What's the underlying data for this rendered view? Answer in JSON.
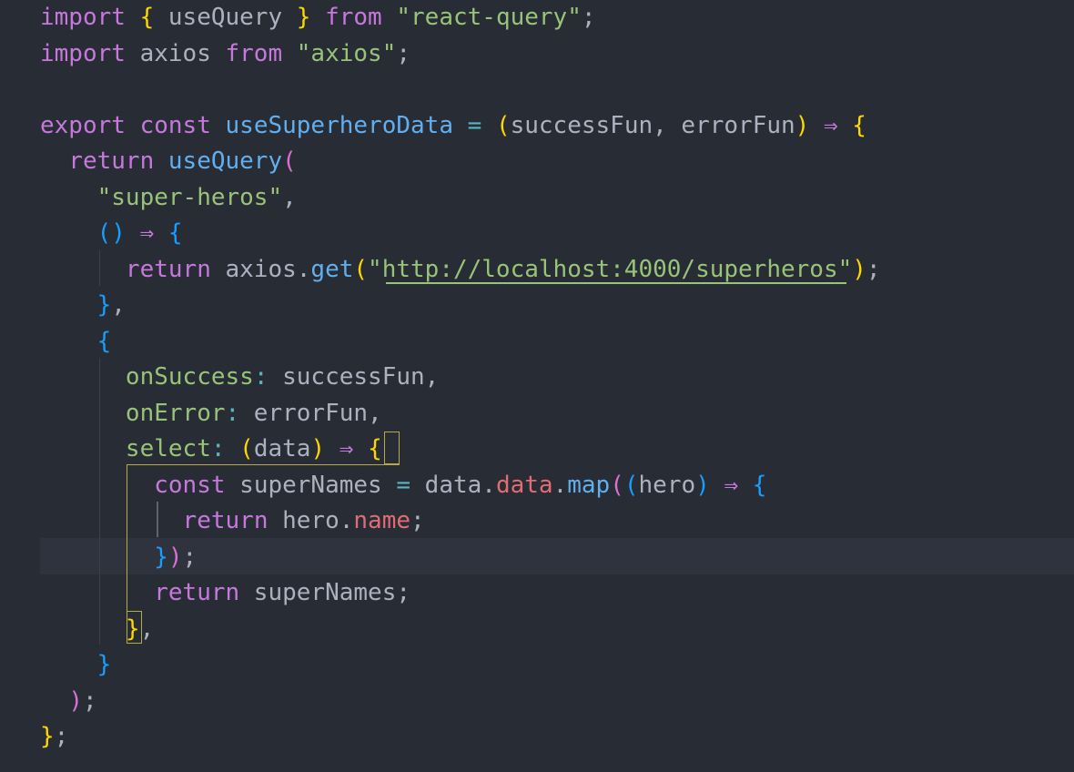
{
  "editor": {
    "theme": {
      "background": "#282c34",
      "current_line": "#2f333d",
      "keyword": "#c678dd",
      "function": "#61afef",
      "string": "#98c379",
      "punctuation": "#abb2bf",
      "property": "#98c379",
      "member": "#e06c75",
      "bracket_gold": "#ffd700",
      "bracket_purple": "#da70d6",
      "bracket_blue": "#179fff",
      "operator": "#56b6c2",
      "bracket_match_border": "#b8a84a"
    },
    "lines": [
      {
        "tokens": [
          {
            "t": "import",
            "c": "keyword"
          },
          {
            "t": " "
          },
          {
            "t": "{",
            "c": "bracket_gold"
          },
          {
            "t": " useQuery "
          },
          {
            "t": "}",
            "c": "bracket_gold"
          },
          {
            "t": " "
          },
          {
            "t": "from",
            "c": "keyword"
          },
          {
            "t": " "
          },
          {
            "t": "\"react-query\"",
            "c": "string"
          },
          {
            "t": ";"
          }
        ]
      },
      {
        "tokens": [
          {
            "t": "import",
            "c": "keyword"
          },
          {
            "t": " axios "
          },
          {
            "t": "from",
            "c": "keyword"
          },
          {
            "t": " "
          },
          {
            "t": "\"axios\"",
            "c": "string"
          },
          {
            "t": ";"
          }
        ]
      },
      {
        "tokens": []
      },
      {
        "tokens": [
          {
            "t": "export",
            "c": "keyword"
          },
          {
            "t": " "
          },
          {
            "t": "const",
            "c": "keyword"
          },
          {
            "t": " "
          },
          {
            "t": "useSuperheroData",
            "c": "function"
          },
          {
            "t": " "
          },
          {
            "t": "=",
            "c": "operator"
          },
          {
            "t": " "
          },
          {
            "t": "(",
            "c": "bracket_gold"
          },
          {
            "t": "successFun, errorFun"
          },
          {
            "t": ")",
            "c": "bracket_gold"
          },
          {
            "t": " "
          },
          {
            "t": "⇒",
            "c": "keyword"
          },
          {
            "t": " "
          },
          {
            "t": "{",
            "c": "bracket_gold"
          }
        ]
      },
      {
        "tokens": [
          {
            "t": "  "
          },
          {
            "t": "return",
            "c": "keyword"
          },
          {
            "t": " "
          },
          {
            "t": "useQuery",
            "c": "function"
          },
          {
            "t": "(",
            "c": "bracket_purple"
          }
        ]
      },
      {
        "tokens": [
          {
            "t": "    "
          },
          {
            "t": "\"super-heros\"",
            "c": "string"
          },
          {
            "t": ","
          }
        ]
      },
      {
        "tokens": [
          {
            "t": "    "
          },
          {
            "t": "()",
            "c": "bracket_blue"
          },
          {
            "t": " "
          },
          {
            "t": "⇒",
            "c": "keyword"
          },
          {
            "t": " "
          },
          {
            "t": "{",
            "c": "bracket_blue"
          }
        ]
      },
      {
        "tokens": [
          {
            "t": "      "
          },
          {
            "t": "return",
            "c": "keyword"
          },
          {
            "t": " axios"
          },
          {
            "t": "."
          },
          {
            "t": "get",
            "c": "function"
          },
          {
            "t": "(",
            "c": "bracket_gold"
          },
          {
            "t": "\"http://localhost:4000/superheros\"",
            "c": "string"
          },
          {
            "t": ")",
            "c": "bracket_gold"
          },
          {
            "t": ";"
          }
        ]
      },
      {
        "tokens": [
          {
            "t": "    "
          },
          {
            "t": "}",
            "c": "bracket_blue"
          },
          {
            "t": ","
          }
        ]
      },
      {
        "tokens": [
          {
            "t": "    "
          },
          {
            "t": "{",
            "c": "bracket_blue"
          }
        ]
      },
      {
        "tokens": [
          {
            "t": "      "
          },
          {
            "t": "onSuccess",
            "c": "property"
          },
          {
            "t": ":",
            "c": "operator"
          },
          {
            "t": " successFun,"
          }
        ]
      },
      {
        "tokens": [
          {
            "t": "      "
          },
          {
            "t": "onError",
            "c": "property"
          },
          {
            "t": ":",
            "c": "operator"
          },
          {
            "t": " errorFun,"
          }
        ]
      },
      {
        "tokens": [
          {
            "t": "      "
          },
          {
            "t": "select",
            "c": "property"
          },
          {
            "t": ":",
            "c": "operator"
          },
          {
            "t": " "
          },
          {
            "t": "(",
            "c": "bracket_gold"
          },
          {
            "t": "data"
          },
          {
            "t": ")",
            "c": "bracket_gold"
          },
          {
            "t": " "
          },
          {
            "t": "⇒",
            "c": "keyword"
          },
          {
            "t": " "
          },
          {
            "t": "{",
            "c": "bracket_gold"
          }
        ]
      },
      {
        "tokens": [
          {
            "t": "        "
          },
          {
            "t": "const",
            "c": "keyword"
          },
          {
            "t": " superNames "
          },
          {
            "t": "=",
            "c": "operator"
          },
          {
            "t": " data"
          },
          {
            "t": "."
          },
          {
            "t": "data",
            "c": "member"
          },
          {
            "t": "."
          },
          {
            "t": "map",
            "c": "function"
          },
          {
            "t": "(",
            "c": "bracket_purple"
          },
          {
            "t": "(",
            "c": "bracket_blue"
          },
          {
            "t": "hero"
          },
          {
            "t": ")",
            "c": "bracket_blue"
          },
          {
            "t": " "
          },
          {
            "t": "⇒",
            "c": "keyword"
          },
          {
            "t": " "
          },
          {
            "t": "{",
            "c": "bracket_blue"
          }
        ]
      },
      {
        "tokens": [
          {
            "t": "          "
          },
          {
            "t": "return",
            "c": "keyword"
          },
          {
            "t": " hero"
          },
          {
            "t": "."
          },
          {
            "t": "name",
            "c": "member"
          },
          {
            "t": ";"
          }
        ]
      },
      {
        "tokens": [
          {
            "t": "        "
          },
          {
            "t": "}",
            "c": "bracket_blue"
          },
          {
            "t": ")",
            "c": "bracket_purple"
          },
          {
            "t": ";"
          }
        ]
      },
      {
        "tokens": [
          {
            "t": "        "
          },
          {
            "t": "return",
            "c": "keyword"
          },
          {
            "t": " superNames;"
          }
        ]
      },
      {
        "tokens": [
          {
            "t": "      "
          },
          {
            "t": "}",
            "c": "bracket_gold"
          },
          {
            "t": ","
          }
        ]
      },
      {
        "tokens": [
          {
            "t": "    "
          },
          {
            "t": "}",
            "c": "bracket_blue"
          }
        ]
      },
      {
        "tokens": [
          {
            "t": "  "
          },
          {
            "t": ")",
            "c": "bracket_purple"
          },
          {
            "t": ";"
          }
        ]
      },
      {
        "tokens": [
          {
            "t": "}",
            "c": "bracket_gold"
          },
          {
            "t": ";"
          }
        ]
      }
    ]
  }
}
